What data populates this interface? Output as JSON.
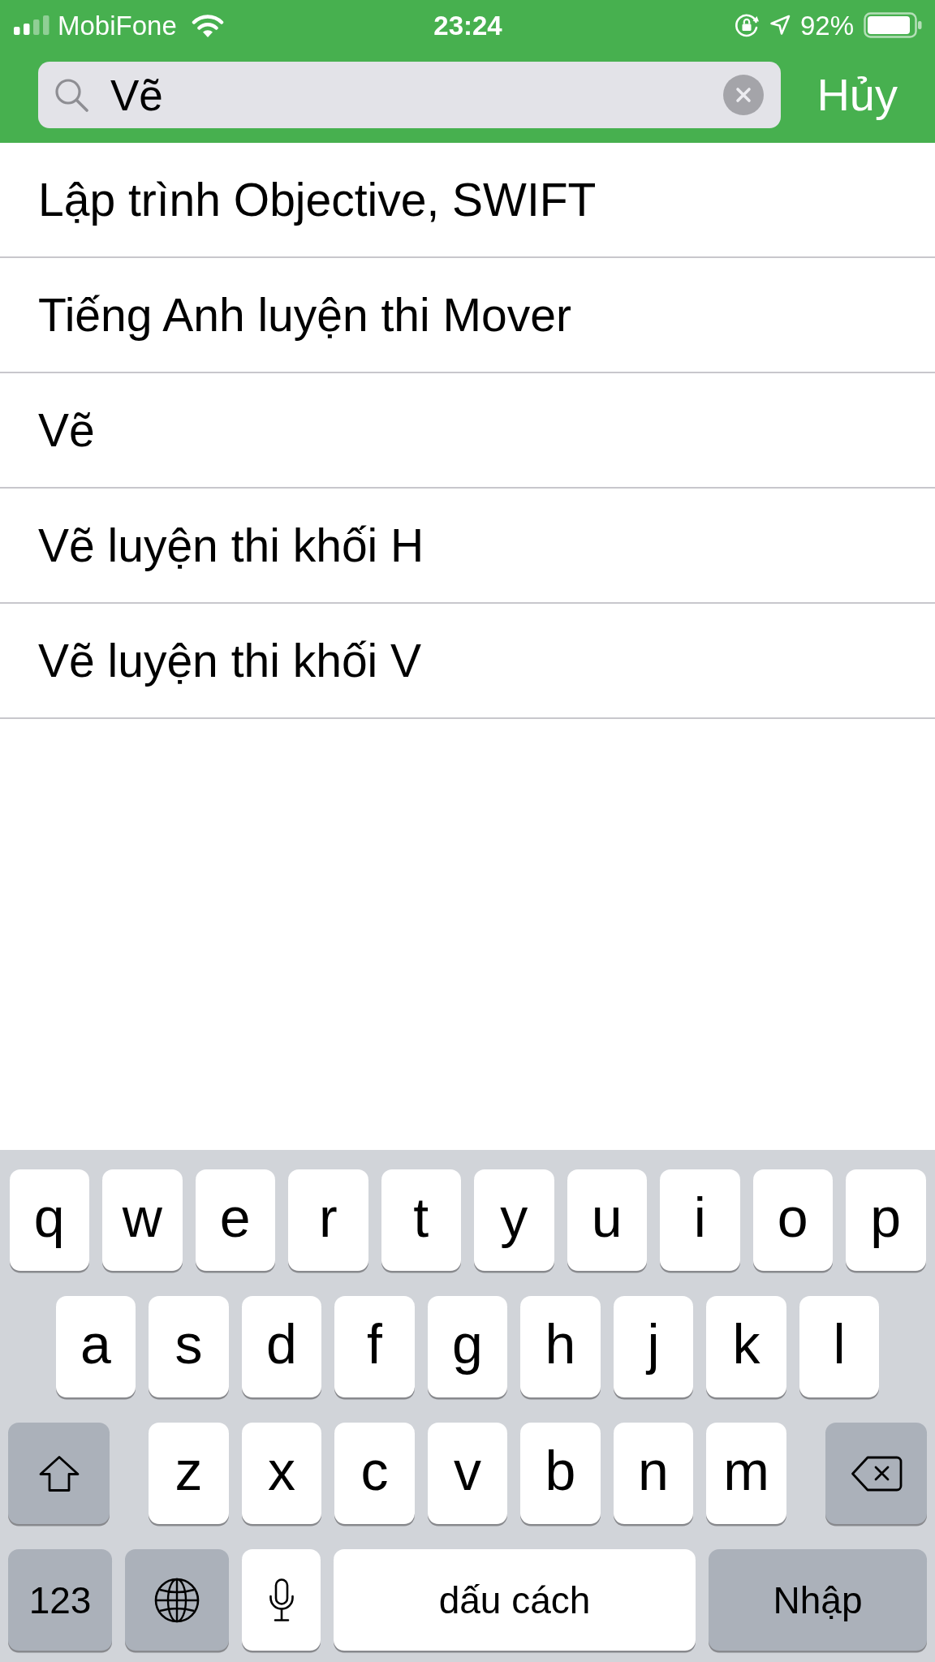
{
  "status_bar": {
    "carrier": "MobiFone",
    "time": "23:24",
    "battery": "92%"
  },
  "search": {
    "value": "Vẽ",
    "cancel": "Hủy"
  },
  "results": [
    "Lập trình Objective, SWIFT",
    "Tiếng Anh luyện thi Mover",
    "Vẽ",
    "Vẽ luyện thi khối H",
    "Vẽ luyện thi khối V"
  ],
  "keyboard": {
    "rows": [
      {
        "keys": [
          {
            "kind": "letter",
            "label": "q"
          },
          {
            "kind": "letter",
            "label": "w"
          },
          {
            "kind": "letter",
            "label": "e"
          },
          {
            "kind": "letter",
            "label": "r"
          },
          {
            "kind": "letter",
            "label": "t"
          },
          {
            "kind": "letter",
            "label": "y"
          },
          {
            "kind": "letter",
            "label": "u"
          },
          {
            "kind": "letter",
            "label": "i"
          },
          {
            "kind": "letter",
            "label": "o"
          },
          {
            "kind": "letter",
            "label": "p"
          }
        ]
      },
      {
        "keys": [
          {
            "kind": "letter",
            "label": "a"
          },
          {
            "kind": "letter",
            "label": "s"
          },
          {
            "kind": "letter",
            "label": "d"
          },
          {
            "kind": "letter",
            "label": "f"
          },
          {
            "kind": "letter",
            "label": "g"
          },
          {
            "kind": "letter",
            "label": "h"
          },
          {
            "kind": "letter",
            "label": "j"
          },
          {
            "kind": "letter",
            "label": "k"
          },
          {
            "kind": "letter",
            "label": "l"
          }
        ]
      },
      {
        "keys": [
          {
            "kind": "shift"
          },
          {
            "kind": "letter",
            "label": "z"
          },
          {
            "kind": "letter",
            "label": "x"
          },
          {
            "kind": "letter",
            "label": "c"
          },
          {
            "kind": "letter",
            "label": "v"
          },
          {
            "kind": "letter",
            "label": "b"
          },
          {
            "kind": "letter",
            "label": "n"
          },
          {
            "kind": "letter",
            "label": "m"
          },
          {
            "kind": "backspace"
          }
        ]
      },
      {
        "keys": [
          {
            "kind": "numbers",
            "label": "123"
          },
          {
            "kind": "globe"
          },
          {
            "kind": "mic"
          },
          {
            "kind": "space",
            "label": "dấu cách"
          },
          {
            "kind": "return",
            "label": "Nhập"
          }
        ]
      }
    ]
  }
}
